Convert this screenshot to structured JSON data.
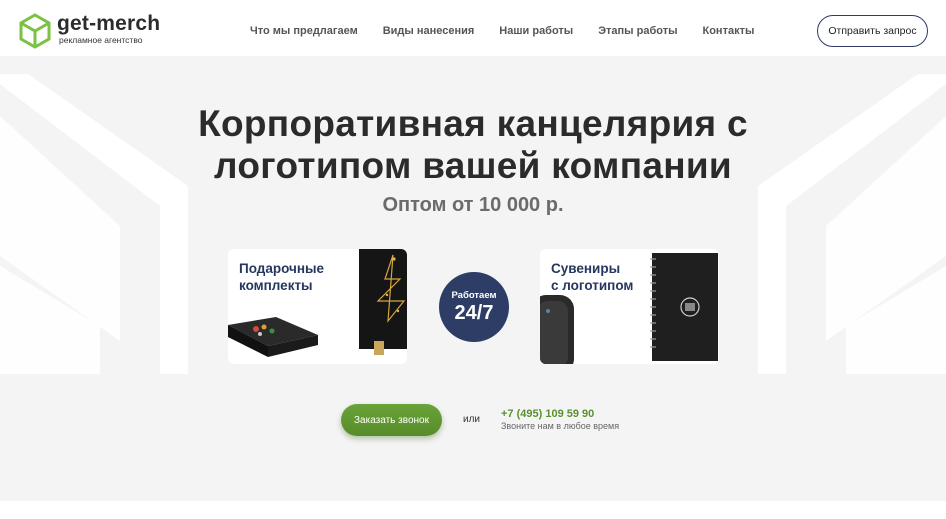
{
  "brand": {
    "name": "get-merch",
    "tagline": "рекламное агентство",
    "accent_green": "#7bc143",
    "accent_navy": "#2d3d66"
  },
  "nav": {
    "items": [
      {
        "label": "Что мы предлагаем"
      },
      {
        "label": "Виды нанесения"
      },
      {
        "label": "Наши работы"
      },
      {
        "label": "Этапы работы"
      },
      {
        "label": "Контакты"
      }
    ],
    "cta_label": "Отправить запрос"
  },
  "hero": {
    "title_line1": "Корпоративная канцелярия с",
    "title_line2": "логотипом вашей компании",
    "subtitle": "Оптом от 10 000 р.",
    "cards": [
      {
        "title": "Подарочные\nкомплекты",
        "icon": "gift-set-image"
      },
      {
        "title": "Сувениры\nс логотипом",
        "icon": "souvenir-image"
      }
    ],
    "badge_line1": "Работаем",
    "badge_line2": "24/7",
    "call_button": "Заказать звонок",
    "or": "или",
    "phone": "+7 (495) 109 59 90",
    "phone_note": "Звоните нам в любое время"
  }
}
